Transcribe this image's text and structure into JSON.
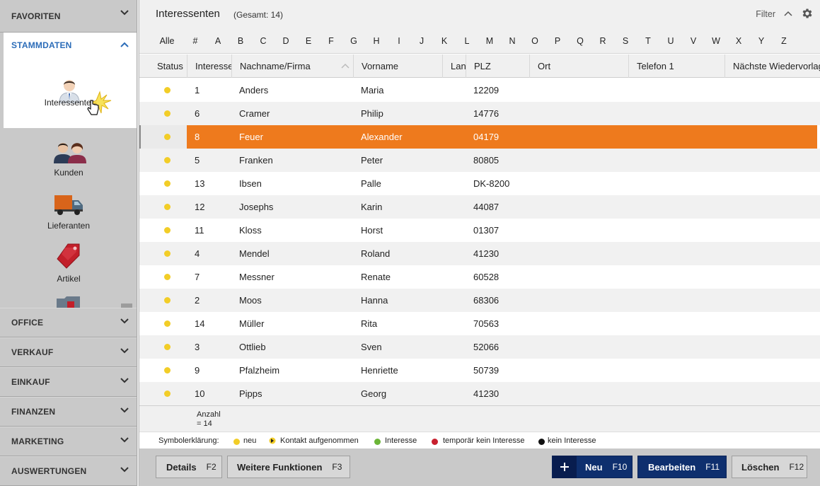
{
  "sidebar": {
    "sections_top": {
      "favoriten": "FAVORITEN",
      "stammdaten": "STAMMDATEN"
    },
    "stammdaten_items": [
      {
        "label": "Interessenten"
      },
      {
        "label": "Kunden"
      },
      {
        "label": "Lieferanten"
      },
      {
        "label": "Artikel"
      }
    ],
    "sections_bottom": [
      "OFFICE",
      "VERKAUF",
      "EINKAUF",
      "FINANZEN",
      "MARKETING",
      "AUSWERTUNGEN"
    ]
  },
  "header": {
    "title": "Interessenten",
    "count": "(Gesamt: 14)",
    "filter": "Filter"
  },
  "alphabet": [
    "Alle",
    "#",
    "A",
    "B",
    "C",
    "D",
    "E",
    "F",
    "G",
    "H",
    "I",
    "J",
    "K",
    "L",
    "M",
    "N",
    "O",
    "P",
    "Q",
    "R",
    "S",
    "T",
    "U",
    "V",
    "W",
    "X",
    "Y",
    "Z"
  ],
  "table": {
    "columns": [
      "Status",
      "Interessentennummer",
      "Nachname/Firma",
      "Vorname",
      "Land",
      "PLZ",
      "Ort",
      "Telefon 1",
      "Nächste Wiedervorlage"
    ],
    "rows": [
      {
        "nr": "1",
        "name": "Anders",
        "vorname": "Maria",
        "plz": "12209"
      },
      {
        "nr": "6",
        "name": "Cramer",
        "vorname": "Philip",
        "plz": "14776"
      },
      {
        "nr": "8",
        "name": "Feuer",
        "vorname": "Alexander",
        "plz": "04179"
      },
      {
        "nr": "5",
        "name": "Franken",
        "vorname": "Peter",
        "plz": "80805"
      },
      {
        "nr": "13",
        "name": "Ibsen",
        "vorname": "Palle",
        "plz": "DK-8200"
      },
      {
        "nr": "12",
        "name": "Josephs",
        "vorname": "Karin",
        "plz": "44087"
      },
      {
        "nr": "11",
        "name": "Kloss",
        "vorname": "Horst",
        "plz": "01307"
      },
      {
        "nr": "4",
        "name": "Mendel",
        "vorname": "Roland",
        "plz": "41230"
      },
      {
        "nr": "7",
        "name": "Messner",
        "vorname": "Renate",
        "plz": "60528"
      },
      {
        "nr": "2",
        "name": "Moos",
        "vorname": "Hanna",
        "plz": "68306"
      },
      {
        "nr": "14",
        "name": "Müller",
        "vorname": "Rita",
        "plz": "70563"
      },
      {
        "nr": "3",
        "name": "Ottlieb",
        "vorname": "Sven",
        "plz": "52066"
      },
      {
        "nr": "9",
        "name": "Pfalzheim",
        "vorname": "Henriette",
        "plz": "50739"
      },
      {
        "nr": "10",
        "name": "Pipps",
        "vorname": "Georg",
        "plz": "41230"
      }
    ],
    "selected_row": "8",
    "footer": {
      "anzahl_label": "Anzahl",
      "anzahl_value": "= 14"
    }
  },
  "legend": {
    "title": "Symbolerklärung:",
    "items": [
      {
        "label": "neu",
        "color": "#f2cd27"
      },
      {
        "label": "Kontakt aufgenommen",
        "color": "#f2cd27"
      },
      {
        "label": "Interesse",
        "color": "#6bb537"
      },
      {
        "label": "temporär kein Interesse",
        "color": "#c8202e"
      },
      {
        "label": "kein Interesse",
        "color": "#111111"
      }
    ]
  },
  "buttons": {
    "details": {
      "label": "Details",
      "key": "F2"
    },
    "weitere": {
      "label": "Weitere Funktionen",
      "key": "F3"
    },
    "neu": {
      "label": "Neu",
      "key": "F10"
    },
    "bearbeiten": {
      "label": "Bearbeiten",
      "key": "F11"
    },
    "loeschen": {
      "label": "Löschen",
      "key": "F12"
    }
  },
  "colors": {
    "accent_selection": "#ee7a1d",
    "primary_button": "#0e2f6e",
    "status_new": "#f2cd27",
    "sidebar_active_text": "#2b6cb8"
  },
  "icons": {
    "interessenten": "person-icon",
    "kunden": "people-icon",
    "lieferanten": "truck-icon",
    "artikel": "tag-icon",
    "settings": "gear-icon"
  }
}
